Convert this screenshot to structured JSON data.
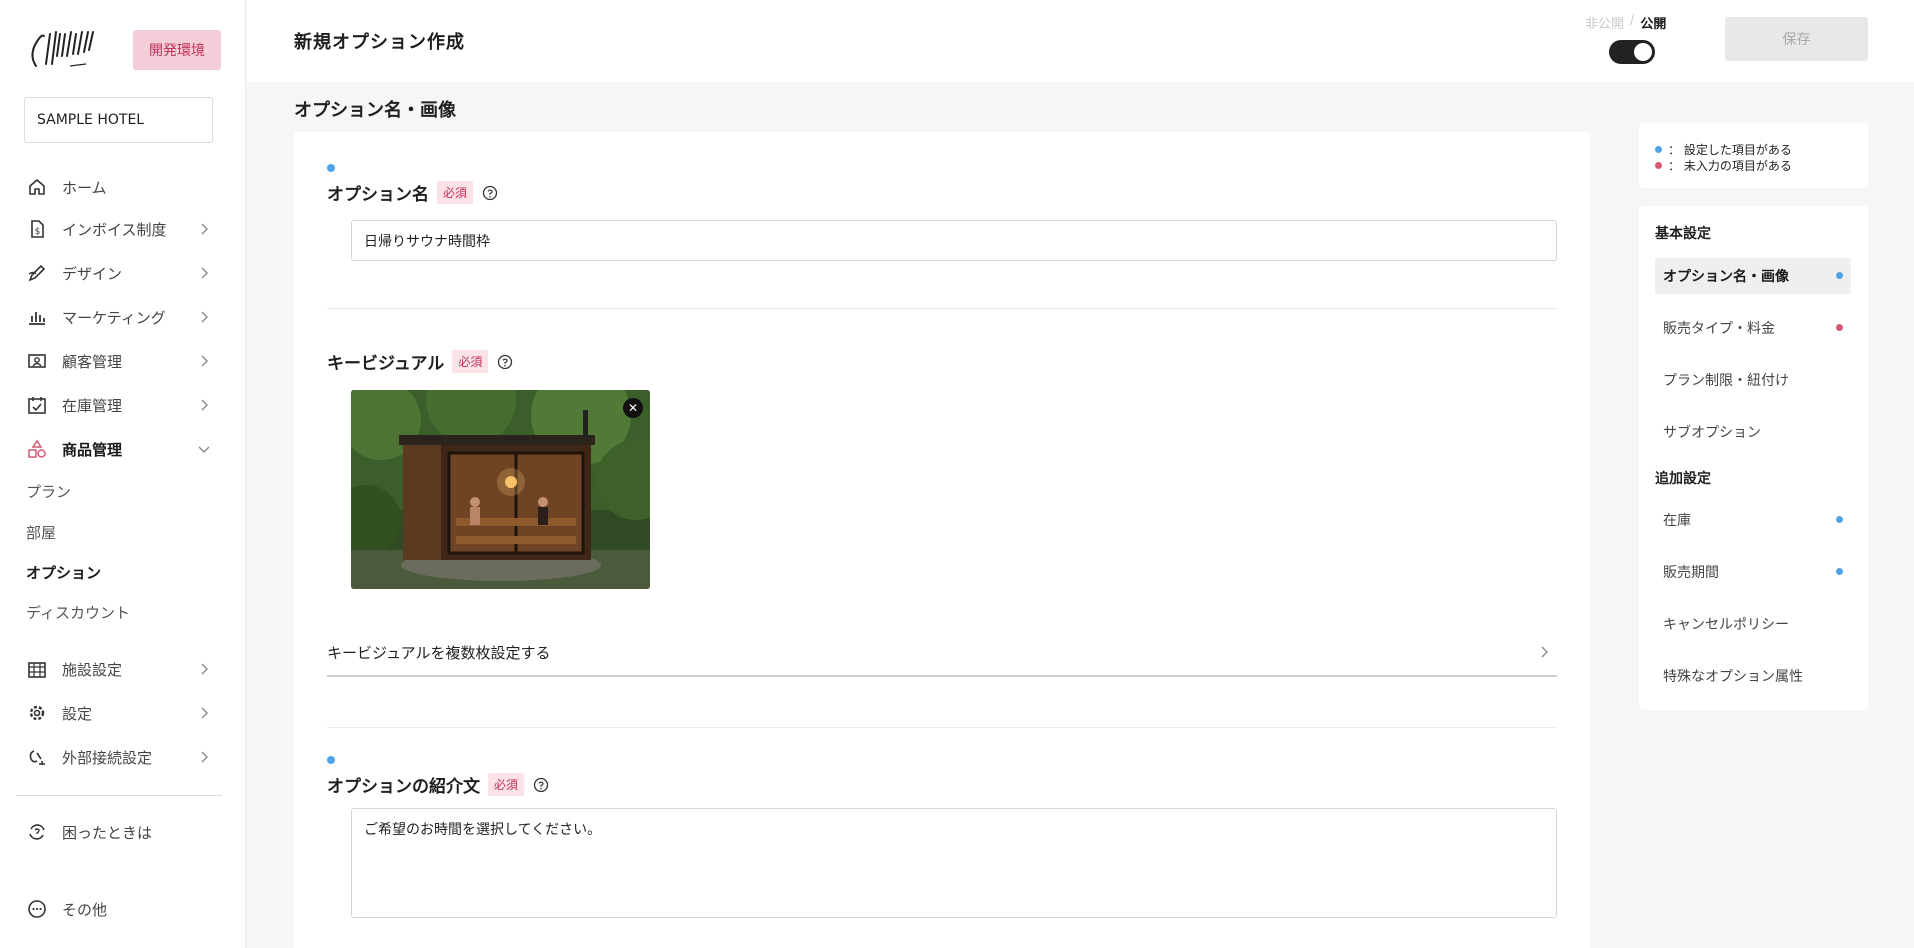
{
  "colors": {
    "accent_blue": "#4ea3e6",
    "accent_red": "#d35a72",
    "brand_pink": "#c2305a"
  },
  "sidebar": {
    "env_badge": "開発環境",
    "hotel_name": "SAMPLE HOTEL",
    "items": [
      {
        "label": "ホーム",
        "icon": "home-icon"
      },
      {
        "label": "インボイス制度",
        "icon": "invoice-icon"
      },
      {
        "label": "デザイン",
        "icon": "pen-icon"
      },
      {
        "label": "マーケティング",
        "icon": "chart-icon"
      },
      {
        "label": "顧客管理",
        "icon": "customer-icon"
      },
      {
        "label": "在庫管理",
        "icon": "calendar-icon"
      },
      {
        "label": "商品管理",
        "icon": "shapes-icon"
      }
    ],
    "sub_items": [
      "プラン",
      "部屋",
      "オプション",
      "ディスカウント"
    ],
    "items2": [
      {
        "label": "施設設定",
        "icon": "building-icon"
      },
      {
        "label": "設定",
        "icon": "gear-icon"
      },
      {
        "label": "外部接続設定",
        "icon": "link-icon"
      }
    ],
    "help": "困ったときは",
    "other": "その他"
  },
  "header": {
    "title": "新規オプション作成",
    "private_label": "非公開",
    "separator": "/",
    "public_label": "公開",
    "save_label": "保存"
  },
  "main": {
    "section_title": "オプション名・画像",
    "option_name": {
      "label": "オプション名",
      "required": "必須",
      "value": "日帰りサウナ時間枠"
    },
    "key_visual": {
      "label": "キービジュアル",
      "required": "必須",
      "multi_label": "キービジュアルを複数枚設定する"
    },
    "description": {
      "label": "オプションの紹介文",
      "required": "必須",
      "value": "ご希望のお時間を選択してください。"
    }
  },
  "legend": {
    "set_label": "： 設定した項目がある",
    "missing_label": "： 未入力の項目がある"
  },
  "toc": {
    "basic_title": "基本設定",
    "basic_items": [
      {
        "label": "オプション名・画像",
        "status": "set"
      },
      {
        "label": "販売タイプ・料金",
        "status": "missing"
      },
      {
        "label": "プラン制限・紐付け",
        "status": ""
      },
      {
        "label": "サブオプション",
        "status": ""
      }
    ],
    "extra_title": "追加設定",
    "extra_items": [
      {
        "label": "在庫",
        "status": "set"
      },
      {
        "label": "販売期間",
        "status": "set"
      },
      {
        "label": "キャンセルポリシー",
        "status": ""
      },
      {
        "label": "特殊なオプション属性",
        "status": ""
      }
    ]
  }
}
